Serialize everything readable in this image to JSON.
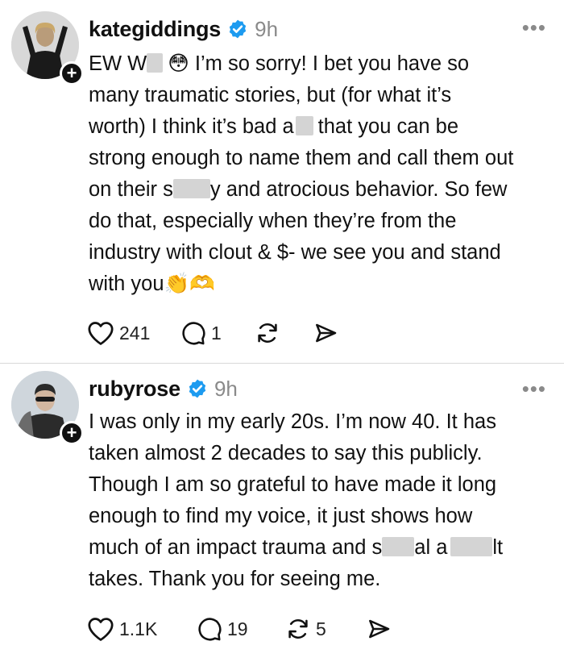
{
  "posts": [
    {
      "username": "kategiddings",
      "time": "9h",
      "lines": [
        [
          "EW W",
          "😳 I’m so sorry! I bet you have so"
        ],
        [
          "many traumatic stories, but (for what it’s"
        ],
        [
          "worth) I think it’s bad a",
          "that you can be"
        ],
        [
          "strong enough to name them and call them out"
        ],
        [
          "on their s",
          "y and atrocious behavior. So few"
        ],
        [
          "do that, especially when they’re from the"
        ],
        [
          "industry with clout & $- we see you and stand"
        ],
        [
          "with you👏🫶"
        ]
      ],
      "likes": "241",
      "replies": "1",
      "reposts": "",
      "icons": {
        "like": "heart-icon",
        "reply": "comment-icon",
        "repost": "repost-icon",
        "share": "share-icon"
      }
    },
    {
      "username": "rubyrose",
      "time": "9h",
      "lines": [
        [
          "I was only in my early 20s. I’m now 40. It has"
        ],
        [
          "taken almost 2 decades to say this publicly."
        ],
        [
          "Though I am so grateful to have made it long"
        ],
        [
          "enough to find my voice, it just shows how"
        ],
        [
          "much of an impact trauma and s",
          "al a",
          "lt"
        ],
        [
          "takes. Thank you for seeing me."
        ]
      ],
      "likes": "1.1K",
      "replies": "19",
      "reposts": "5",
      "icons": {
        "like": "heart-icon",
        "reply": "comment-icon",
        "repost": "repost-icon",
        "share": "share-icon"
      }
    }
  ],
  "colors": {
    "verified": "#1d9bf0",
    "meta": "#8a8a8a",
    "text": "#111111",
    "redaction": "#d4d4d4"
  }
}
